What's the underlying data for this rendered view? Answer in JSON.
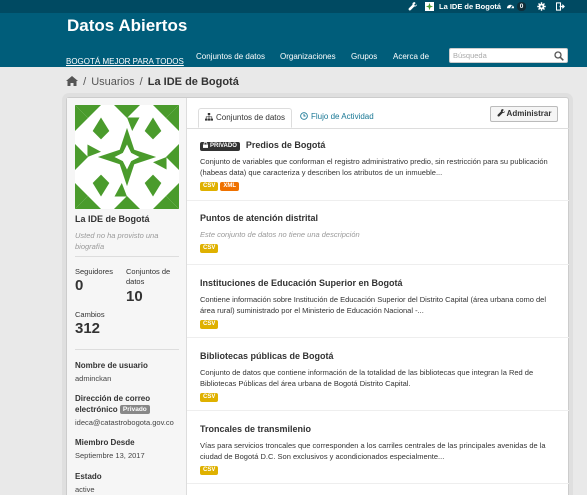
{
  "account": {
    "username": "La IDE de Bogotá",
    "dashboard_count": "0"
  },
  "site": {
    "title": "Datos Abiertos",
    "tagline": "BOGOTÁ MEJOR PARA TODOS"
  },
  "nav": {
    "items": [
      "Conjuntos de datos",
      "Organizaciones",
      "Grupos",
      "Acerca de"
    ]
  },
  "search": {
    "placeholder": "Búsqueda"
  },
  "breadcrumb": {
    "users": "Usuarios",
    "current": "La IDE de Bogotá"
  },
  "profile": {
    "name": "La IDE de Bogotá",
    "description": "Usted no ha provisto una biografía",
    "followers_label": "Seguidores",
    "followers": "0",
    "datasets_label": "Conjuntos de datos",
    "datasets": "10",
    "edits_label": "Cambios",
    "edits": "312",
    "username_label": "Nombre de usuario",
    "username": "adminckan",
    "email_label": "Dirección de correo electrónico",
    "email_badge": "Privado",
    "email": "ideca@catastrobogota.gov.co",
    "member_since_label": "Miembro Desde",
    "member_since": "Septiembre 13, 2017",
    "state_label": "Estado",
    "state": "active"
  },
  "tabs": {
    "datasets": "Conjuntos de datos",
    "activity": "Flujo de Actividad"
  },
  "manage_button": "Administrar",
  "colors": {
    "masthead": "#005d7a",
    "account_bar": "#004a62",
    "csv": "#dfb100",
    "xml": "#ef7100",
    "logo_green": "#4a9b2c",
    "link": "#187794"
  },
  "datasets": [
    {
      "private": true,
      "private_label": "PRIVADO",
      "title": "Predios de Bogotá",
      "description": "Conjunto de variables que conforman el registro administrativo predio, sin restricción para su publicación (habeas data) que caracteriza y describen los atributos de un inmueble...",
      "formats": [
        "CSV",
        "XML"
      ]
    },
    {
      "private": false,
      "title": "Puntos de atención distrital",
      "description": "Este conjunto de datos no tiene una descripción",
      "empty": true,
      "formats": [
        "CSV"
      ]
    },
    {
      "private": false,
      "title": "Instituciones de Educación Superior en Bogotá",
      "description": "Contiene información sobre Institución de Educación Superior del Distrito Capital (área urbana como del área rural) suministrado por el Ministerio de Educación Nacional -...",
      "formats": [
        "CSV"
      ]
    },
    {
      "private": false,
      "title": "Bibliotecas públicas de Bogotá",
      "description": "Conjunto de datos que contiene información de la totalidad de las bibliotecas que integran la Red de Bibliotecas Públicas del área urbana de Bogotá Distrito Capital.",
      "formats": [
        "CSV"
      ]
    },
    {
      "private": false,
      "title": "Troncales de transmilenio",
      "description": "Vías para servicios troncales que corresponden a los carriles centrales de las principales avenidas de la ciudad de Bogotá D.C. Son exclusivos y acondicionados especialmente...",
      "formats": [
        "CSV"
      ]
    }
  ]
}
